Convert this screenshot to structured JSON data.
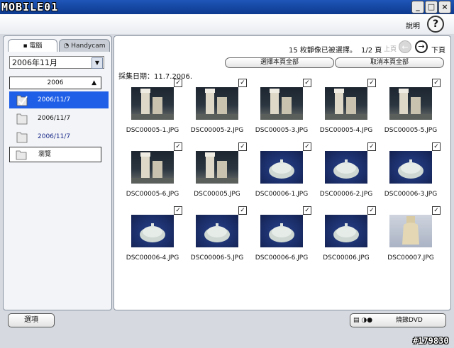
{
  "window": {
    "brand": "MOBILE01",
    "minimize_symbol": "_",
    "maximize_symbol": "□",
    "close_symbol": "×"
  },
  "menu": {
    "help_label": "說明",
    "help_symbol": "?"
  },
  "sidebar": {
    "tabs": [
      {
        "label": "電腦"
      },
      {
        "label": "Handycam"
      }
    ],
    "month_select": {
      "value": "2006年11月",
      "arrow": "▼"
    },
    "year_header": {
      "label": "2006",
      "arrow": "▲"
    },
    "folders": [
      {
        "label": "2006/11/7"
      },
      {
        "label": "2006/11/7"
      },
      {
        "label": "2006/11/7"
      }
    ],
    "browse_label": "瀏覽"
  },
  "main": {
    "status_text": "15 枚靜像已被選擇。",
    "page_info": "1/2 頁",
    "prev_label": "上頁",
    "next_label": "下頁",
    "prev_symbol": "←",
    "next_symbol": "→",
    "select_all_label": "選擇本頁全部",
    "deselect_all_label": "取消本頁全部",
    "capture_date": "採集日期：11.7.2006.",
    "checkmark": "✓",
    "thumbnails": [
      {
        "name": "DSC00005-1.JPG",
        "kind": "tube",
        "checked": true
      },
      {
        "name": "DSC00005-2.JPG",
        "kind": "tube",
        "checked": true
      },
      {
        "name": "DSC00005-3.JPG",
        "kind": "tube",
        "checked": true
      },
      {
        "name": "DSC00005-4.JPG",
        "kind": "tube",
        "checked": true
      },
      {
        "name": "DSC00005-5.JPG",
        "kind": "tube",
        "checked": true
      },
      {
        "name": "DSC00005-6.JPG",
        "kind": "tube",
        "checked": true
      },
      {
        "name": "DSC00005.JPG",
        "kind": "tube",
        "checked": true
      },
      {
        "name": "DSC00006-1.JPG",
        "kind": "blue",
        "checked": true
      },
      {
        "name": "DSC00006-2.JPG",
        "kind": "blue",
        "checked": true
      },
      {
        "name": "DSC00006-3.JPG",
        "kind": "blue",
        "checked": true
      },
      {
        "name": "DSC00006-4.JPG",
        "kind": "blue",
        "checked": true
      },
      {
        "name": "DSC00006-5.JPG",
        "kind": "blue",
        "checked": true
      },
      {
        "name": "DSC00006-6.JPG",
        "kind": "blue",
        "checked": true
      },
      {
        "name": "DSC00006.JPG",
        "kind": "blue",
        "checked": true
      },
      {
        "name": "DSC00007.JPG",
        "kind": "bottle",
        "checked": true
      }
    ]
  },
  "footer": {
    "options_label": "選項",
    "dvd_icons": "▤ ◑●",
    "dvd_label": "燒錄DVD",
    "watermark": "#179830"
  }
}
